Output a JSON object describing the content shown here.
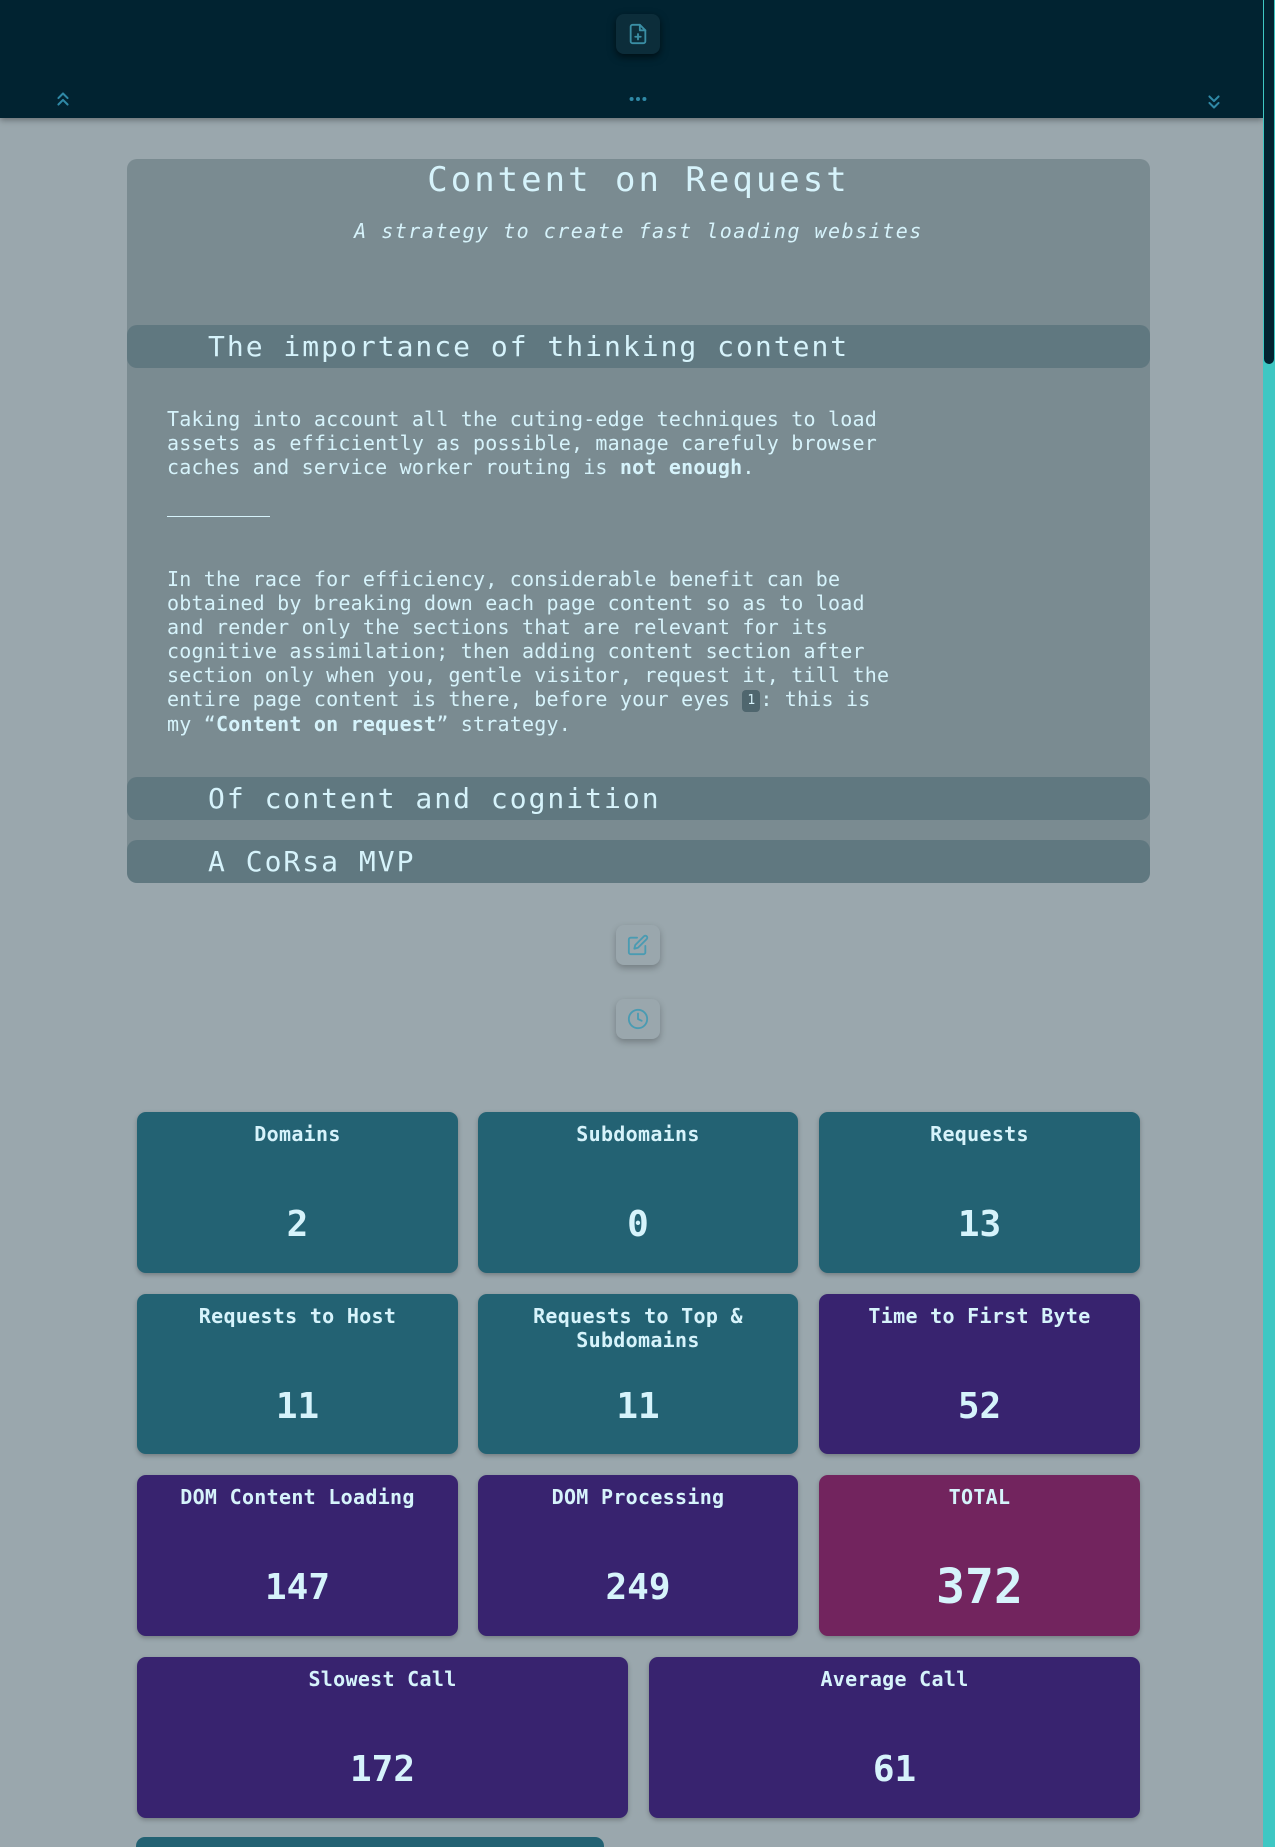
{
  "toolbar": {
    "new_document_icon": "file-plus-icon",
    "collapse_all_icon": "chevrons-up-icon",
    "more_icon": "more-horizontal-icon",
    "expand_all_icon": "chevrons-down-icon"
  },
  "article": {
    "title": "Content on Request",
    "subtitle": "A strategy to create fast loading websites",
    "sections": [
      {
        "heading": "The importance of thinking content"
      },
      {
        "heading": "Of content and cognition"
      },
      {
        "heading": "A CoRsa MVP"
      }
    ],
    "p1": {
      "line1": "Taking into account all the cuting-edge techniques to load",
      "line2": "assets as efficiently as possible, manage carefuly browser",
      "line3_pre": "caches and service worker routing is ",
      "line3_bold": "not enough",
      "line3_post": "."
    },
    "p2": {
      "line1": "In the race for efficiency, considerable benefit can be",
      "line2": "obtained by breaking down each page content so as to load",
      "line3": "and render only the sections that are relevant for its",
      "line4": "cognitive assimilation; then adding content section after",
      "line5": "section only when you, gentle visitor, request it, till the",
      "line6_pre": "entire page content is there, before your eyes ",
      "footnote": "1",
      "line6_post": ": this is",
      "line7_pre": "my “",
      "line7_bold": "Content on request",
      "line7_post": "” strategy."
    }
  },
  "actions": {
    "edit_icon": "edit-icon",
    "history_icon": "clock-icon"
  },
  "metrics": [
    {
      "label": "Domains",
      "value": "2"
    },
    {
      "label": "Subdomains",
      "value": "0"
    },
    {
      "label": "Requests",
      "value": "13"
    },
    {
      "label": "Requests to Host",
      "value": "11"
    },
    {
      "label": "Requests to Top & Subdomains",
      "value": "11"
    },
    {
      "label": "Time to First Byte",
      "value": "52"
    },
    {
      "label": "DOM Content Loading",
      "value": "147"
    },
    {
      "label": "DOM Processing",
      "value": "249"
    },
    {
      "label": "TOTAL",
      "value": "372"
    },
    {
      "label": "Slowest Call",
      "value": "172"
    },
    {
      "label": "Average Call",
      "value": "61"
    }
  ],
  "colors": {
    "topbar": "#012331",
    "background": "#9aa7ad",
    "card_teal": "#236273",
    "card_purple": "#38236f",
    "card_total": "#72245e",
    "accent": "#3ec7c3"
  }
}
